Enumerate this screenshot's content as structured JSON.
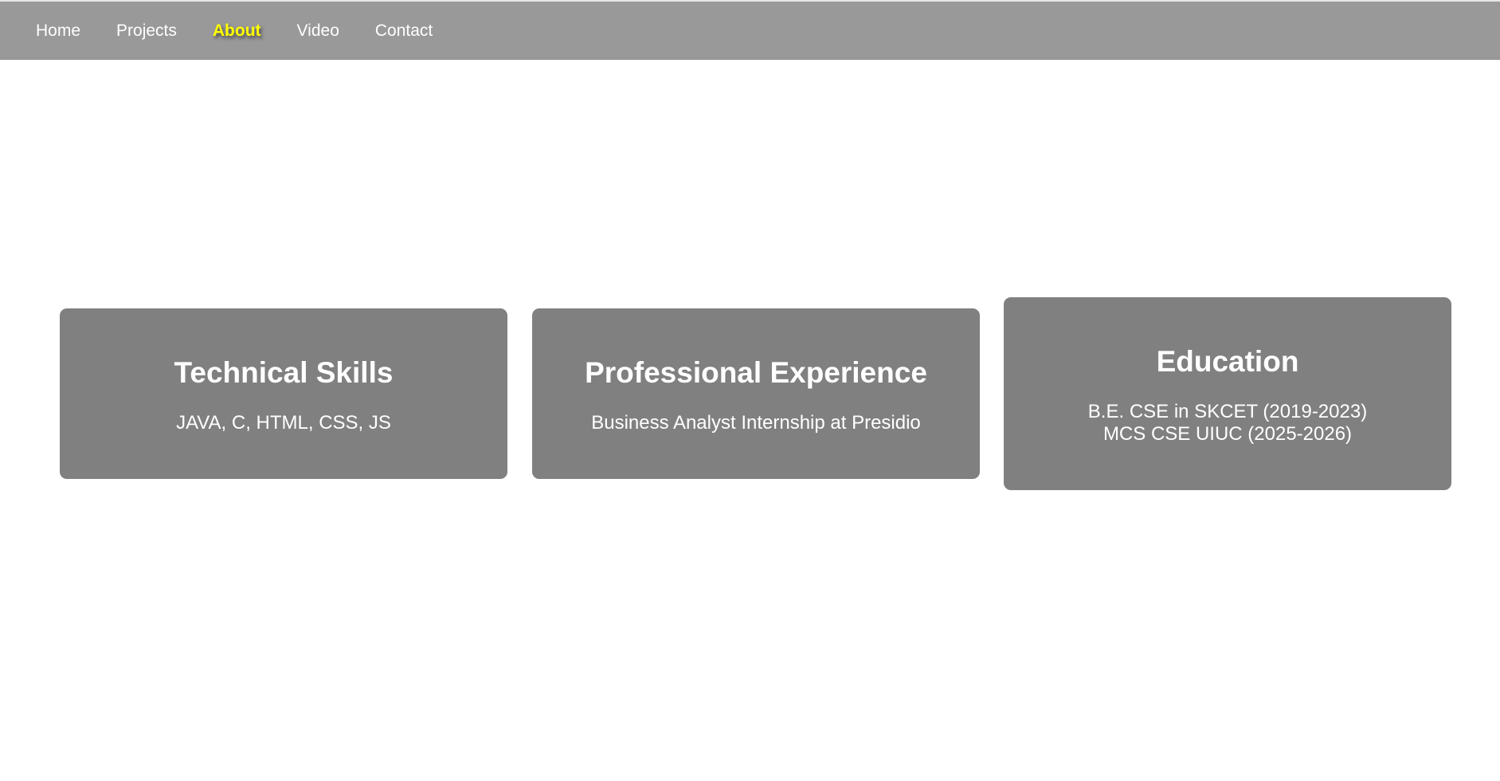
{
  "nav": {
    "items": [
      {
        "label": "Home",
        "active": false
      },
      {
        "label": "Projects",
        "active": false
      },
      {
        "label": "About",
        "active": true
      },
      {
        "label": "Video",
        "active": false
      },
      {
        "label": "Contact",
        "active": false
      }
    ]
  },
  "cards": [
    {
      "title": "Technical Skills",
      "lines": [
        "JAVA, C, HTML, CSS, JS"
      ]
    },
    {
      "title": "Professional Experience",
      "lines": [
        "Business Analyst Internship at Presidio"
      ]
    },
    {
      "title": "Education",
      "lines": [
        "B.E. CSE in SKCET (2019-2023)",
        "MCS CSE UIUC (2025-2026)"
      ]
    }
  ],
  "colors": {
    "navbar_bg": "#999999",
    "nav_text": "#ffffff",
    "nav_active": "#ffff00",
    "card_bg": "#808080",
    "card_text": "#ffffff",
    "page_bg": "#ffffff"
  }
}
